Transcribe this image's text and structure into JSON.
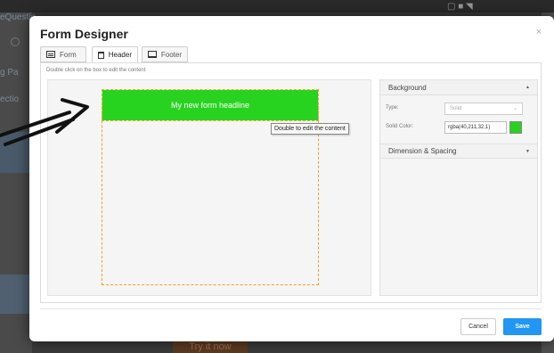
{
  "background": {
    "left_texts": [
      "eQuestio",
      "g Pa",
      "ectio"
    ],
    "bottom_button": "Try it now",
    "top_icons": "▢ ■ ◥"
  },
  "modal": {
    "title": "Form Designer",
    "close": "×",
    "tabs": [
      {
        "label": "Form",
        "icon": "form-icon"
      },
      {
        "label": "Header",
        "icon": "header-icon"
      },
      {
        "label": "Footer",
        "icon": "footer-icon"
      }
    ],
    "hint": "Double click on the box to edit the content",
    "headline": "My new form headline",
    "tooltip": "Double to edit the content",
    "accent_color": "#28d320",
    "side": {
      "background_header": "Background",
      "type_label": "Type:",
      "type_value": "Solid",
      "color_label": "Solid Color:",
      "color_value": "rgba(40,211,32,1)",
      "dimension_header": "Dimension & Spacing"
    },
    "buttons": {
      "cancel": "Cancel",
      "save": "Save"
    }
  }
}
